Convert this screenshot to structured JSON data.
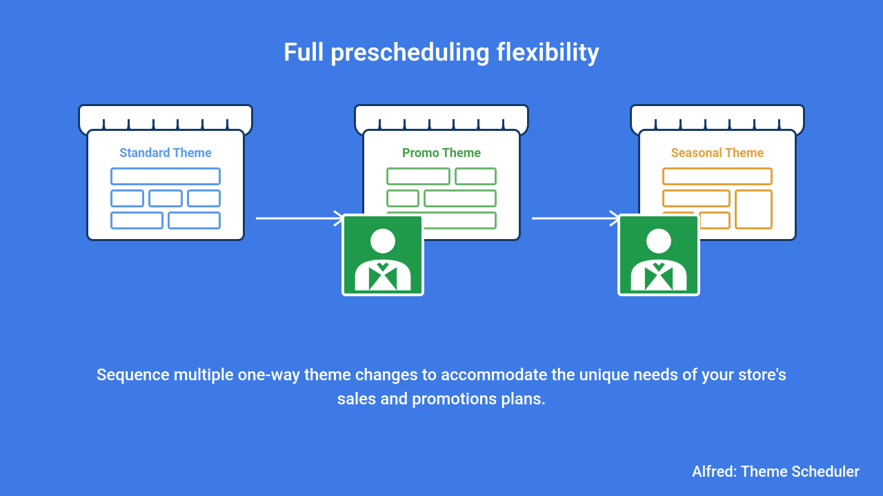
{
  "title": "Full prescheduling flexibility",
  "subtitle": "Sequence multiple one-way theme changes to accommodate the unique needs of your store's sales and promotions plans.",
  "footer": "Alfred: Theme Scheduler",
  "stores": {
    "standard": {
      "label": "Standard Theme",
      "color": "#5b9bec"
    },
    "promo": {
      "label": "Promo Theme",
      "color": "#47a04a"
    },
    "seasonal": {
      "label": "Seasonal Theme",
      "color": "#e0a23b"
    }
  },
  "colors": {
    "background": "#3d7ae5",
    "outline": "#143a6b",
    "butler_bg": "#1f9a4a",
    "white": "#ffffff"
  },
  "icons": {
    "arrow": "arrow-right-icon",
    "butler": "butler-icon",
    "store": "storefront-icon"
  }
}
